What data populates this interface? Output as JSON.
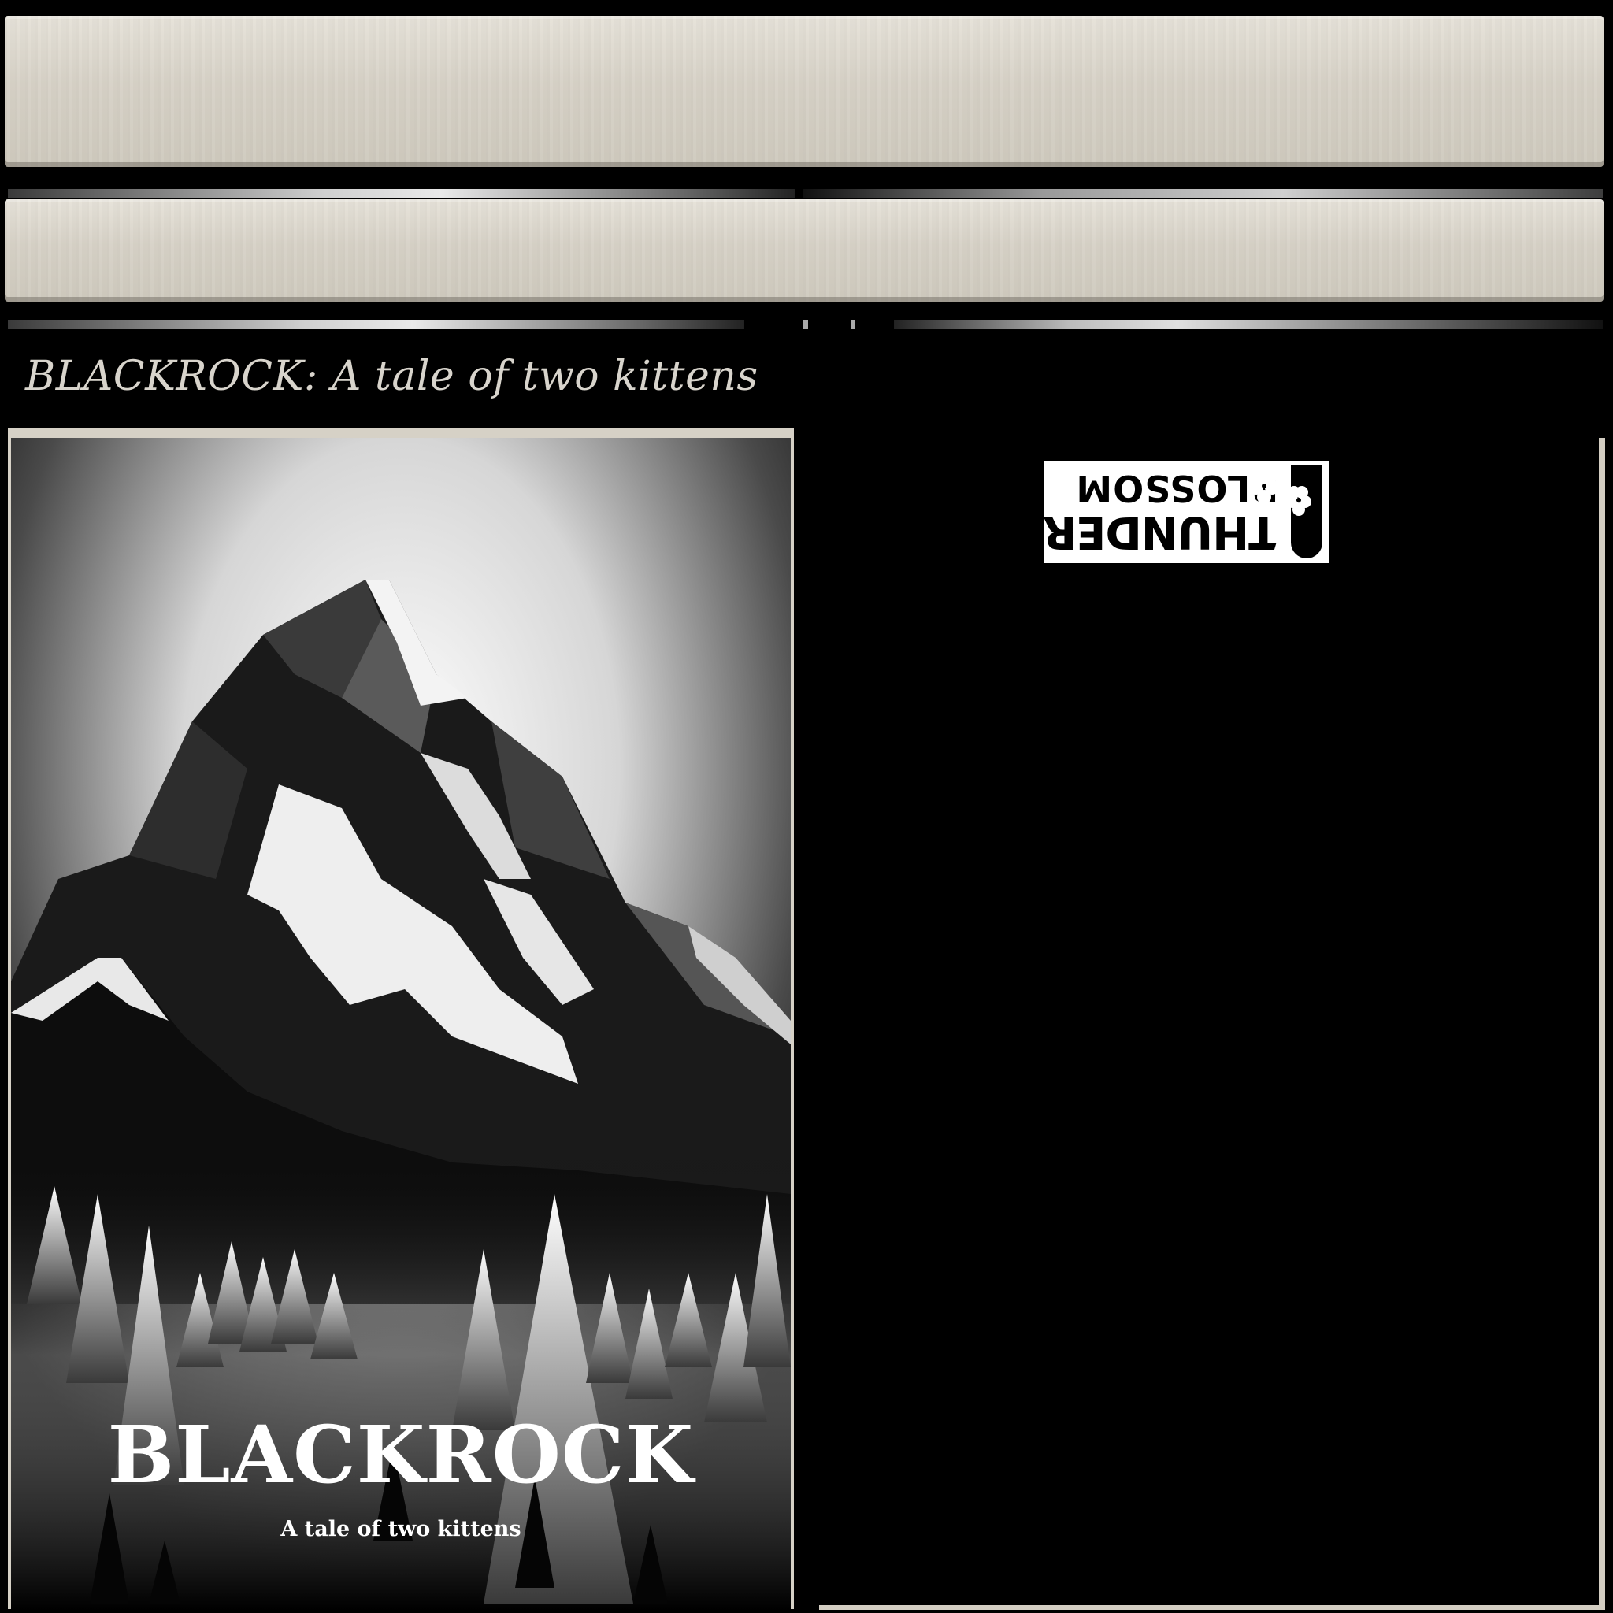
{
  "page": {
    "book_title": "BLACKROCK: A tale of two kittens"
  },
  "cover": {
    "title": "BLACKROCK",
    "subtitle": "A tale of two kittens",
    "artwork": "black-and-white snowy mountain peak above pine forest"
  },
  "logo": {
    "line1": "THUNDER",
    "line2": "BLOSSOM",
    "icon": "lightning-blossom-icon",
    "orientation": "upside-down"
  },
  "colors": {
    "background": "#000000",
    "plank": "#d9d5cb",
    "title_text": "#d8d4cc"
  }
}
